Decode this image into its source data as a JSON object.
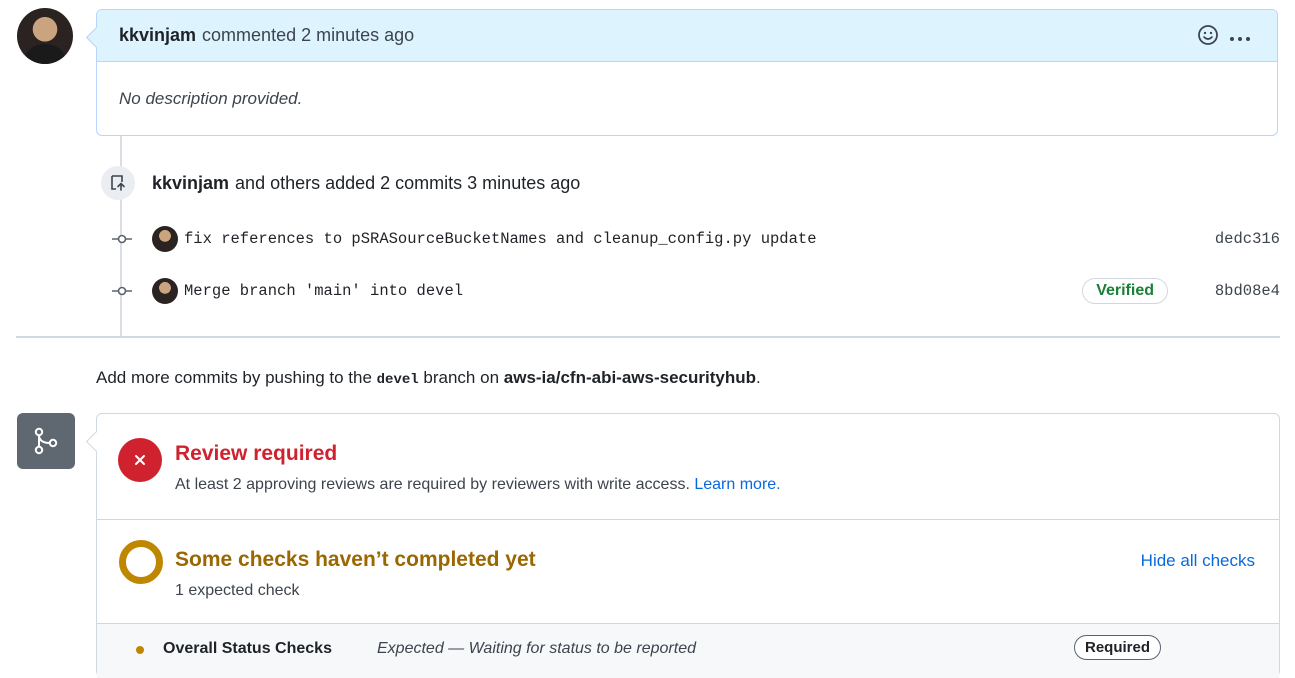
{
  "comment": {
    "author": "kkvinjam",
    "meta": "commented 2 minutes ago",
    "body": "No description provided.",
    "actions": {
      "emoji_icon": "smiley-icon",
      "more_icon": "kebab-horizontal-icon",
      "more_label": "···"
    }
  },
  "commits": {
    "author": "kkvinjam",
    "summary": "and others added 2 commits 3 minutes ago",
    "items": [
      {
        "message": "fix references to pSRASourceBucketNames and cleanup_config.py update",
        "sha": "dedc316",
        "verified": ""
      },
      {
        "message": "Merge branch 'main' into devel",
        "sha": "8bd08e4",
        "verified": "Verified"
      }
    ]
  },
  "push_note": {
    "prefix": "Add more commits by pushing to the",
    "branch": "devel",
    "middle": "branch on",
    "repo": "aws-ia/cfn-abi-aws-securityhub",
    "suffix": "."
  },
  "review": {
    "title": "Review required",
    "subtitle": "At least 2 approving reviews are required by reviewers with write access.",
    "link": "Learn more."
  },
  "checks": {
    "title": "Some checks haven’t completed yet",
    "subtitle": "1 expected check",
    "hide_link": "Hide all checks",
    "items": [
      {
        "name": "Overall Status Checks",
        "description": "Expected — Waiting for status to be reported",
        "badge": "Required"
      }
    ]
  },
  "colors": {
    "accent_blue": "#0969da",
    "danger_red": "#cf222e",
    "attention_yellow": "#bf8700",
    "success_green": "#1a7f37",
    "comment_header_bg": "#ddf4ff"
  }
}
